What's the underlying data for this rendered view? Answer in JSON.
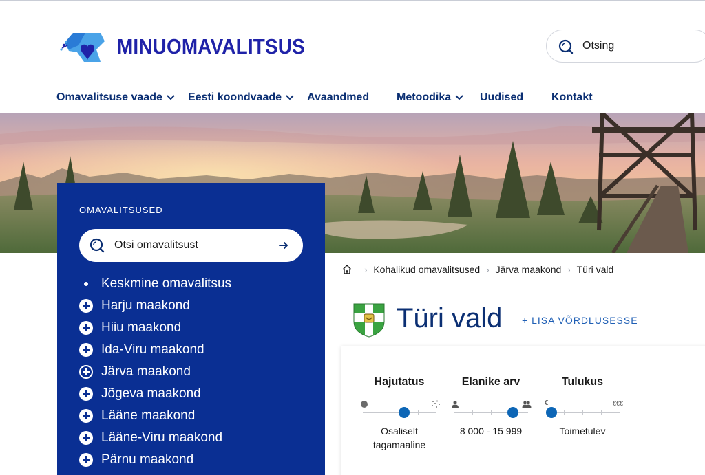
{
  "header": {
    "brand": "MINUOMAVALITSUS",
    "search_label": "Otsing"
  },
  "nav": [
    {
      "label": "Omavalitsuse vaade",
      "has_dropdown": true
    },
    {
      "label": "Eesti koondvaade",
      "has_dropdown": true
    },
    {
      "label": "Avaandmed",
      "has_dropdown": false
    },
    {
      "label": "Metoodika",
      "has_dropdown": true
    },
    {
      "label": "Uudised",
      "has_dropdown": false
    },
    {
      "label": "Kontakt",
      "has_dropdown": false
    }
  ],
  "sidebar": {
    "title": "OMAVALITSUSED",
    "search_placeholder": "Otsi omavalitsust",
    "regions": [
      {
        "label": "Keskmine omavalitsus",
        "icon": "bullet"
      },
      {
        "label": "Harju maakond",
        "icon": "plus-circle-icon"
      },
      {
        "label": "Hiiu maakond",
        "icon": "plus-circle-icon"
      },
      {
        "label": "Ida-Viru maakond",
        "icon": "plus-circle-icon"
      },
      {
        "label": "Järva maakond",
        "icon": "plus-circle-outline-icon"
      },
      {
        "label": "Jõgeva maakond",
        "icon": "plus-circle-icon"
      },
      {
        "label": "Lääne maakond",
        "icon": "plus-circle-icon"
      },
      {
        "label": "Lääne-Viru maakond",
        "icon": "plus-circle-icon"
      },
      {
        "label": "Pärnu maakond",
        "icon": "plus-circle-icon"
      }
    ]
  },
  "breadcrumb": [
    "Kohalikud omavalitsused",
    "Järva maakond",
    "Türi vald"
  ],
  "page": {
    "title": "Türi vald",
    "compare_label": "+ LISA VÕRDLUSESSE"
  },
  "metrics": [
    {
      "title": "Hajutatus",
      "value_line1": "Osaliselt",
      "value_line2": "tagamaaline",
      "level": 0.5,
      "icon_left": "dot-icon",
      "icon_right": "scatter-dots-icon"
    },
    {
      "title": "Elanike arv",
      "value_line1": "8 000 - 15 999",
      "value_line2": "",
      "level": 0.75,
      "icon_left": "person-icon",
      "icon_right": "people-icon"
    },
    {
      "title": "Tulukus",
      "value_line1": "Toimetulev",
      "value_line2": "",
      "level": 0.0,
      "icon_left_text": "€",
      "icon_right_text": "€€€"
    }
  ],
  "colors": {
    "brand": "#1f22a8",
    "nav_text": "#0b2f73",
    "panel_bg": "#0a2f93",
    "accent": "#0d66b6"
  }
}
